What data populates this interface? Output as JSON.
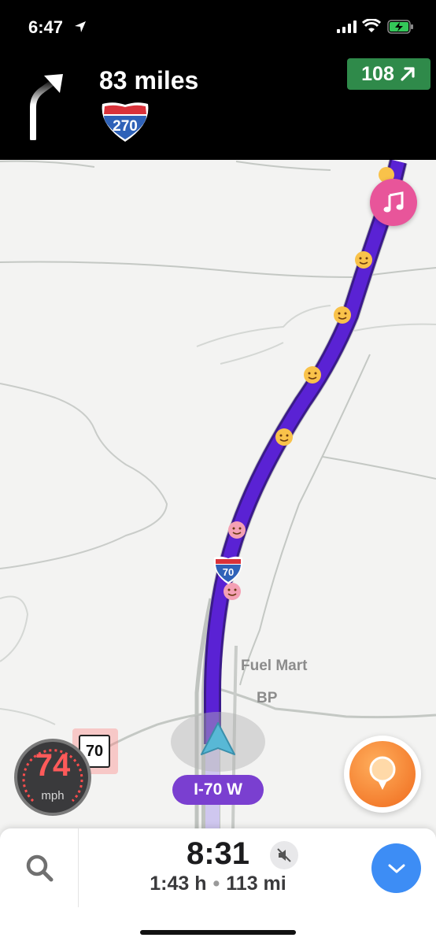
{
  "status_bar": {
    "time": "6:47",
    "icons": [
      "location-arrow-icon",
      "cellular-signal-icon",
      "wifi-icon",
      "battery-charging-icon"
    ]
  },
  "navigation": {
    "maneuver_icon": "turn-right-arrow-icon",
    "distance": "83 miles",
    "route_shield": "270",
    "exit_number": "108",
    "exit_icon": "arrow-up-right-icon",
    "exit_color": "#2f8a4a"
  },
  "map": {
    "route_shield": "70",
    "labels": {
      "fuel_station": "Fuel Mart",
      "gas_brand": "BP"
    },
    "route_color": "#5a22d4",
    "current_road": "I-70 W",
    "speed_limit": "70",
    "music_button_icon": "music-note-icon",
    "report_button_icon": "report-pin-icon"
  },
  "speedometer": {
    "speed": "74",
    "unit": "mph"
  },
  "bottom_bar": {
    "search_icon": "search-icon",
    "eta": "8:31",
    "mute_icon": "sound-off-icon",
    "duration": "1:43 h",
    "separator": "•",
    "distance_remaining": "113 mi",
    "expand_icon": "chevron-down-icon"
  }
}
